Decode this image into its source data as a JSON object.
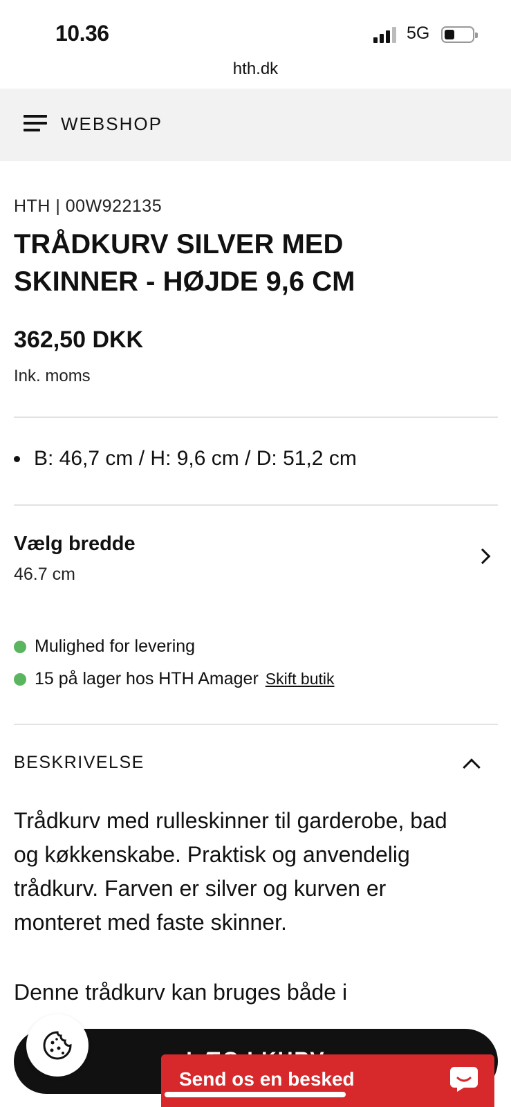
{
  "status_bar": {
    "time": "10.36",
    "network": "5G",
    "url": "hth.dk"
  },
  "header": {
    "menu_label": "WEBSHOP"
  },
  "product": {
    "sku": "HTH | 00W922135",
    "title_line1": "TRÅDKURV SILVER MED",
    "title_line2": "SKINNER - HØJDE 9,6 CM",
    "price": "362,50 DKK",
    "vat_note": "Ink. moms",
    "dimensions": "B: 46,7 cm / H: 9,6 cm / D: 51,2 cm"
  },
  "width_selector": {
    "label": "Vælg bredde",
    "value": "46.7 cm"
  },
  "availability": {
    "delivery": "Mulighed for levering",
    "stock": "15 på lager hos HTH Amager",
    "change_store": "Skift butik",
    "status_color": "#5ab55e"
  },
  "description": {
    "header": "BESKRIVELSE",
    "lines": [
      "Trådkurv med rulleskinner til garderobe, bad",
      "og køkkenskabe. Praktisk og anvendelig",
      "trådkurv. Farven er silver og kurven er",
      "monteret med faste skinner."
    ],
    "line_partial": "Denne trådkurv kan bruges både i"
  },
  "bottom": {
    "cart_label": "LÆG I KURV",
    "chat_label": "Send os en besked",
    "chat_color": "#d7282b"
  },
  "icons": {
    "menu": "hamburger-icon",
    "chevron_right": "chevron-right-icon",
    "chevron_up": "chevron-up-icon",
    "cookie": "cookie-icon",
    "chat": "chat-bubble-icon"
  }
}
